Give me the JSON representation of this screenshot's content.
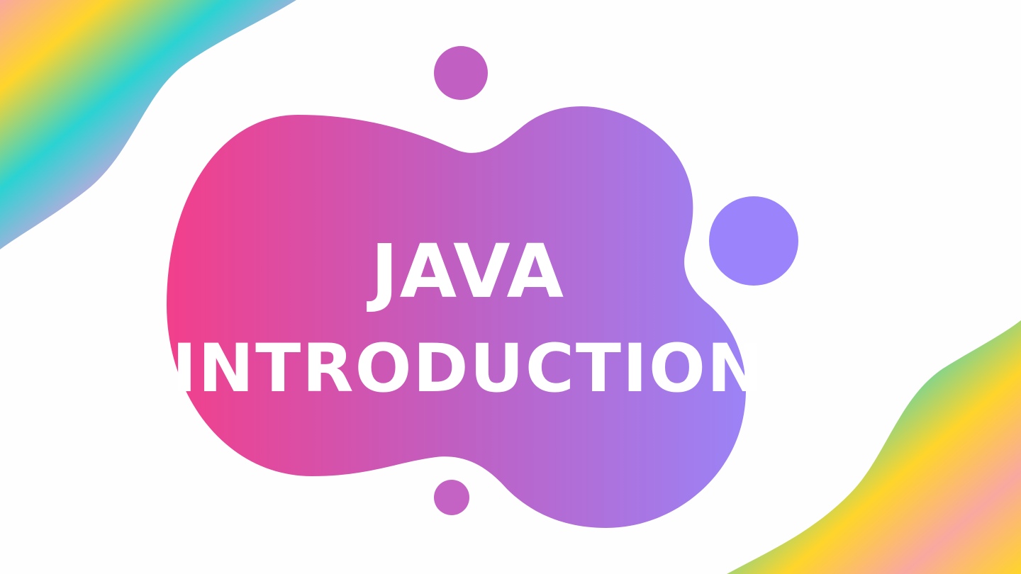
{
  "slide": {
    "title_line_1": "JAVA",
    "title_line_2": "INTRODUCTION"
  },
  "colors": {
    "background": "#fefefe",
    "blob_gradient_start": "#f23f8b",
    "blob_gradient_mid": "#c05fc2",
    "blob_gradient_end": "#9b83f6",
    "dot_top": "#c160c2",
    "dot_right": "#9b84fb",
    "dot_bottom": "#c463c4",
    "wave_pink": "#f79ae3",
    "wave_cyan": "#2ad3d2",
    "wave_yellow": "#ffd52a",
    "wave_peach": "#f9a8a0",
    "title_text": "#ffffff"
  }
}
